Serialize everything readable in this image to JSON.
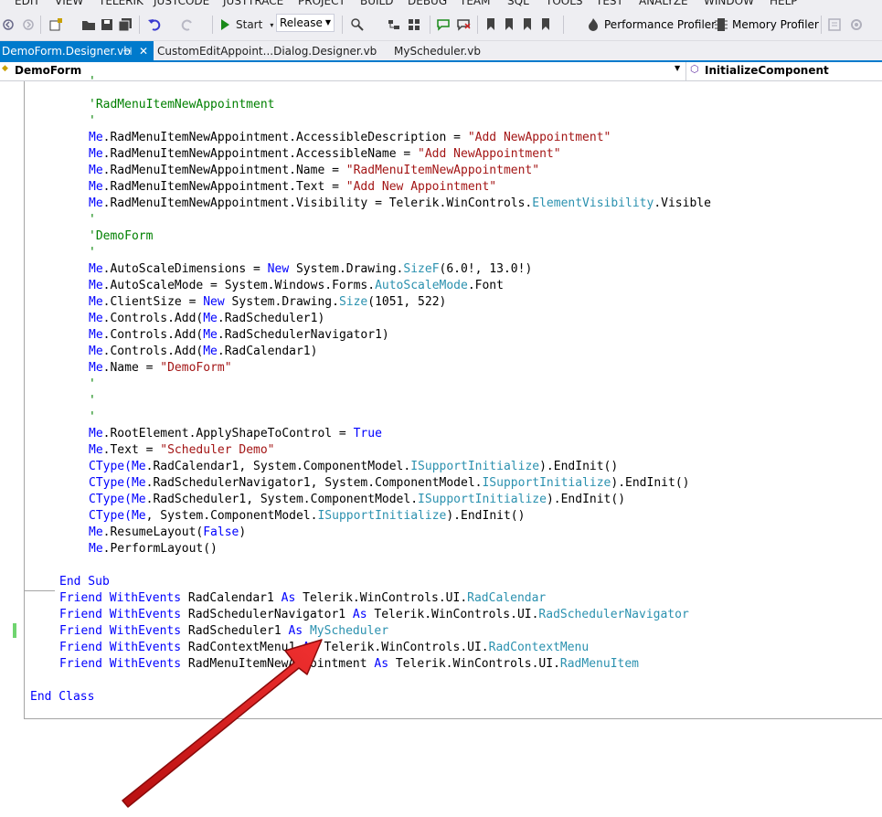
{
  "menubar": {
    "items": [
      "EDIT",
      "VIEW",
      "TELERIK",
      "JUSTCODE",
      "JUSTTRACE",
      "PROJECT",
      "BUILD",
      "DEBUG",
      "TEAM",
      "SQL",
      "TOOLS",
      "TEST",
      "ANALYZE",
      "WINDOW",
      "HELP"
    ]
  },
  "toolbar": {
    "start_label": "Start",
    "config_value": "Release",
    "performance_profiler": "Performance Profiler",
    "memory_profiler": "Memory Profiler"
  },
  "tabs": [
    {
      "label": "DemoForm.Designer.vb",
      "pin": "⊣",
      "close": "✕",
      "active": true
    },
    {
      "label": "CustomEditAppoint...Dialog.Designer.vb",
      "active": false
    },
    {
      "label": "MyScheduler.vb",
      "active": false
    }
  ],
  "navbar": {
    "class_name": "DemoForm",
    "member_name": "InitializeComponent"
  },
  "code": {
    "l1": "'",
    "l2_comment": "'RadMenuItemNewAppointment",
    "l3": "'",
    "access_desc_prop": ".RadMenuItemNewAppointment.AccessibleDescription = ",
    "access_desc_val": "\"Add NewAppointment\"",
    "access_name_prop": ".RadMenuItemNewAppointment.AccessibleName = ",
    "access_name_val": "\"Add NewAppointment\"",
    "name_prop": ".RadMenuItemNewAppointment.Name = ",
    "name_val": "\"RadMenuItemNewAppointment\"",
    "text_prop": ".RadMenuItemNewAppointment.Text = ",
    "text_val": "\"Add New Appointment\"",
    "vis_prop": ".RadMenuItemNewAppointment.Visibility = Telerik.WinControls.",
    "vis_type": "ElementVisibility",
    "vis_end": ".Visible",
    "l9": "'",
    "demoform_comment": "'DemoForm",
    "l11": "'",
    "me": "Me",
    "asd_prop": ".AutoScaleDimensions = ",
    "new_kw": "New",
    "asd_mid": " System.Drawing.",
    "sizef_type": "SizeF",
    "asd_end": "(6.0!, 13.0!)",
    "asm_prop": ".AutoScaleMode = System.Windows.Forms.",
    "asm_type": "AutoScaleMode",
    "asm_end": ".Font",
    "cs_prop": ".ClientSize = ",
    "cs_mid": " System.Drawing.",
    "size_type": "Size",
    "cs_end": "(1051, 522)",
    "ctrl_add": ".Controls.Add(",
    "rs1": ".RadScheduler1)",
    "rsn1": ".RadSchedulerNavigator1)",
    "rc1": ".RadCalendar1)",
    "formname_prop": ".Name = ",
    "formname_val": "\"DemoForm\"",
    "l20": "'",
    "l21": "'",
    "l22": "'",
    "root_prop": ".RootElement.ApplyShapeToControl = ",
    "true_kw": "True",
    "ftext_prop": ".Text = ",
    "ftext_val": "\"Scheduler Demo\"",
    "ctype": "CType(",
    "cal_end": ".RadCalendar1, System.ComponentModel.",
    "isupport": "ISupportInitialize",
    "endinit": ").EndInit()",
    "nav_end": ".RadSchedulerNavigator1, System.ComponentModel.",
    "sch_end": ".RadScheduler1, System.ComponentModel.",
    "me_end": ", System.ComponentModel.",
    "resume": ".ResumeLayout(",
    "false_kw": "False",
    "close_paren": ")",
    "perform": ".PerformLayout()",
    "end_sub": "End Sub",
    "friend": "Friend",
    "withevents": "WithEvents",
    "as_kw": "As",
    "decl1_name": " RadCalendar1 ",
    "decl1_ns": " Telerik.WinControls.UI.",
    "decl1_type": "RadCalendar",
    "decl2_name": " RadSchedulerNavigator1 ",
    "decl2_ns": " Telerik.WinControls.UI.",
    "decl2_type": "RadSchedulerNavigator",
    "decl3_name": " RadScheduler1 ",
    "decl3_type": "MyScheduler",
    "decl4_name": " RadContextMenu1 ",
    "decl4_ns": " Telerik.WinControls.UI.",
    "decl4_type": "RadContextMenu",
    "decl5_name": " RadMenuItemNewAppointment ",
    "decl5_ns": " Telerik.WinControls.UI.",
    "decl5_type": "RadMenuItem",
    "end_class": "End Class"
  },
  "colors": {
    "keyword": "#0000ff",
    "string": "#a31515",
    "type": "#2b91af",
    "comment": "#008000",
    "accent": "#007acc",
    "annotation_arrow": "#e82020"
  }
}
